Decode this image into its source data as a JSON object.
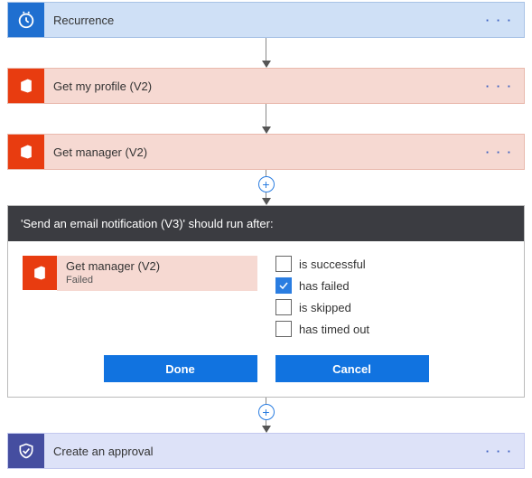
{
  "steps": {
    "recurrence": {
      "label": "Recurrence"
    },
    "profile": {
      "label": "Get my profile (V2)"
    },
    "manager": {
      "label": "Get manager (V2)"
    },
    "approval": {
      "label": "Create an approval"
    }
  },
  "panel": {
    "title": "'Send an email notification (V3)' should run after:",
    "prev": {
      "title": "Get manager (V2)",
      "status": "Failed"
    },
    "options": {
      "success": {
        "label": "is successful",
        "checked": false
      },
      "failed": {
        "label": "has failed",
        "checked": true
      },
      "skipped": {
        "label": "is skipped",
        "checked": false
      },
      "timedout": {
        "label": "has timed out",
        "checked": false
      }
    },
    "buttons": {
      "done": "Done",
      "cancel": "Cancel"
    }
  },
  "icons": {
    "more": "· · ·",
    "plus": "+"
  }
}
